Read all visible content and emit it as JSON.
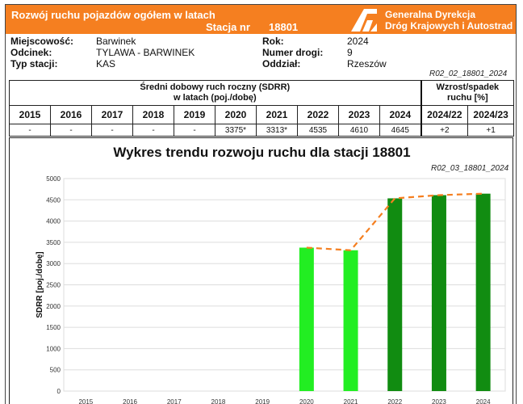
{
  "header": {
    "title": "Rozwój ruchu pojazdów ogółem w latach",
    "station_label": "Stacja nr",
    "station_number": "18801",
    "org_line1": "Generalna Dyrekcja",
    "org_line2": "Dróg Krajowych i Autostrad",
    "logo_icon": "gddkia-road-logo-icon",
    "accent_color": "#f57f20"
  },
  "info": {
    "place_label": "Miejscowość:",
    "place_value": "Barwinek",
    "section_label": "Odcinek:",
    "section_value": "TYLAWA - BARWINEK",
    "type_label": "Typ stacji:",
    "type_value": "KAS",
    "year_label": "Rok:",
    "year_value": "2024",
    "road_label": "Numer drogi:",
    "road_value": "9",
    "branch_label": "Oddział:",
    "branch_value": "Rzeszów"
  },
  "table": {
    "code": "R02_02_18801_2024",
    "sdrr_header_line1": "Średni dobowy ruch roczny (SDRR)",
    "sdrr_header_line2": "w latach (poj./dobę)",
    "growth_header_line1": "Wzrost/spadek",
    "growth_header_line2": "ruchu [%]",
    "years": [
      "2015",
      "2016",
      "2017",
      "2018",
      "2019",
      "2020",
      "2021",
      "2022",
      "2023",
      "2024"
    ],
    "values": [
      "-",
      "-",
      "-",
      "-",
      "-",
      "3375*",
      "3313*",
      "4535",
      "4610",
      "4645"
    ],
    "growth_headers": [
      "2024/22",
      "2024/23"
    ],
    "growth_values": [
      "+2",
      "+1"
    ]
  },
  "chart_data": {
    "type": "bar",
    "title": "Wykres trendu rozwoju ruchu dla stacji 18801",
    "code": "R02_03_18801_2024",
    "ylabel": "SDRR [poj./dobę]",
    "xlabel": "",
    "categories": [
      "2015",
      "2016",
      "2017",
      "2018",
      "2019",
      "2020",
      "2021",
      "2022",
      "2023",
      "2024"
    ],
    "values": [
      null,
      null,
      null,
      null,
      null,
      3375,
      3313,
      4535,
      4610,
      4645
    ],
    "ylim": [
      0,
      5000
    ],
    "yticks": [
      0,
      500,
      1000,
      1500,
      2000,
      2500,
      3000,
      3500,
      4000,
      4500,
      5000
    ],
    "grid": true,
    "trend_line": "dashed",
    "colors": {
      "estimated_bar": "#22ee22",
      "measured_bar": "#118c11",
      "trend": "#f57f20",
      "grid": "#dddddd"
    }
  }
}
